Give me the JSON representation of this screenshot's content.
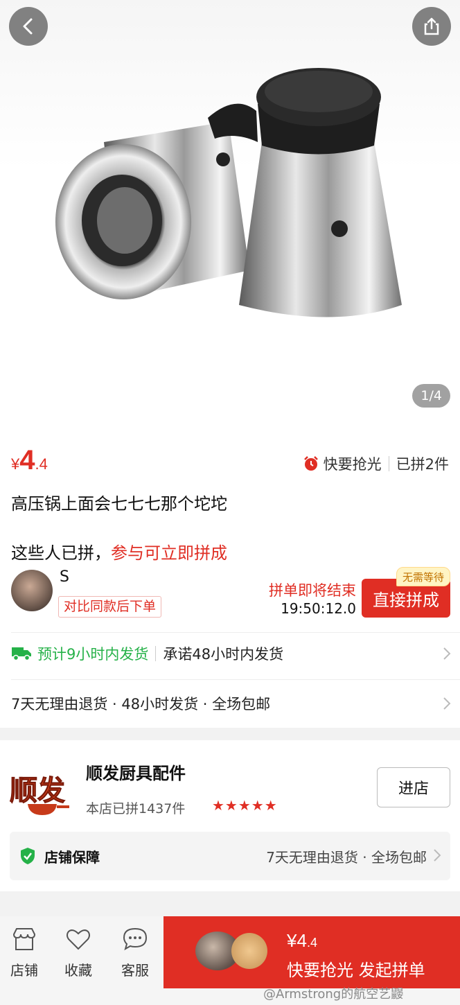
{
  "gallery": {
    "counter": "1/4"
  },
  "price": {
    "currency": "¥",
    "integer": "4",
    "decimal": ".4"
  },
  "status": {
    "hot_label": "快要抢光",
    "grouped_count": "已拼2件"
  },
  "product": {
    "title": "高压锅上面会七七七那个坨坨"
  },
  "group_hint": {
    "prefix": "这些人已拼，",
    "highlight": "参与可立即拼成"
  },
  "group": {
    "user_name": "S",
    "compare_tag": "对比同款后下单",
    "ending_label": "拼单即将结束",
    "countdown": "19:50:12.0",
    "join_label": "直接拼成",
    "no_wait_badge": "无需等待"
  },
  "shipping": {
    "estimate": "预计9小时内发货",
    "promise": "承诺48小时内发货",
    "services": "7天无理由退货 · 48小时发货 · 全场包邮"
  },
  "store": {
    "logo_text": "顺发",
    "name": "顺发厨具配件",
    "sold": "本店已拼1437件",
    "rating": 4.5,
    "stars": "★★★★★",
    "enter_label": "进店",
    "guarantee_title": "店铺保障",
    "guarantee_items": "7天无理由退货 · 全场包邮"
  },
  "bottom_bar": {
    "tabs": [
      {
        "label": "店铺",
        "icon": "store-icon"
      },
      {
        "label": "收藏",
        "icon": "heart-icon"
      },
      {
        "label": "客服",
        "icon": "chat-icon"
      }
    ],
    "buy_price_currency": "¥",
    "buy_price_integer": "4",
    "buy_price_decimal": ".4",
    "buy_label": "快要抢光 发起拼单"
  },
  "watermark": "@Armstrong的航空艺鼹",
  "colors": {
    "accent": "#e02e24",
    "green": "#25b148"
  }
}
